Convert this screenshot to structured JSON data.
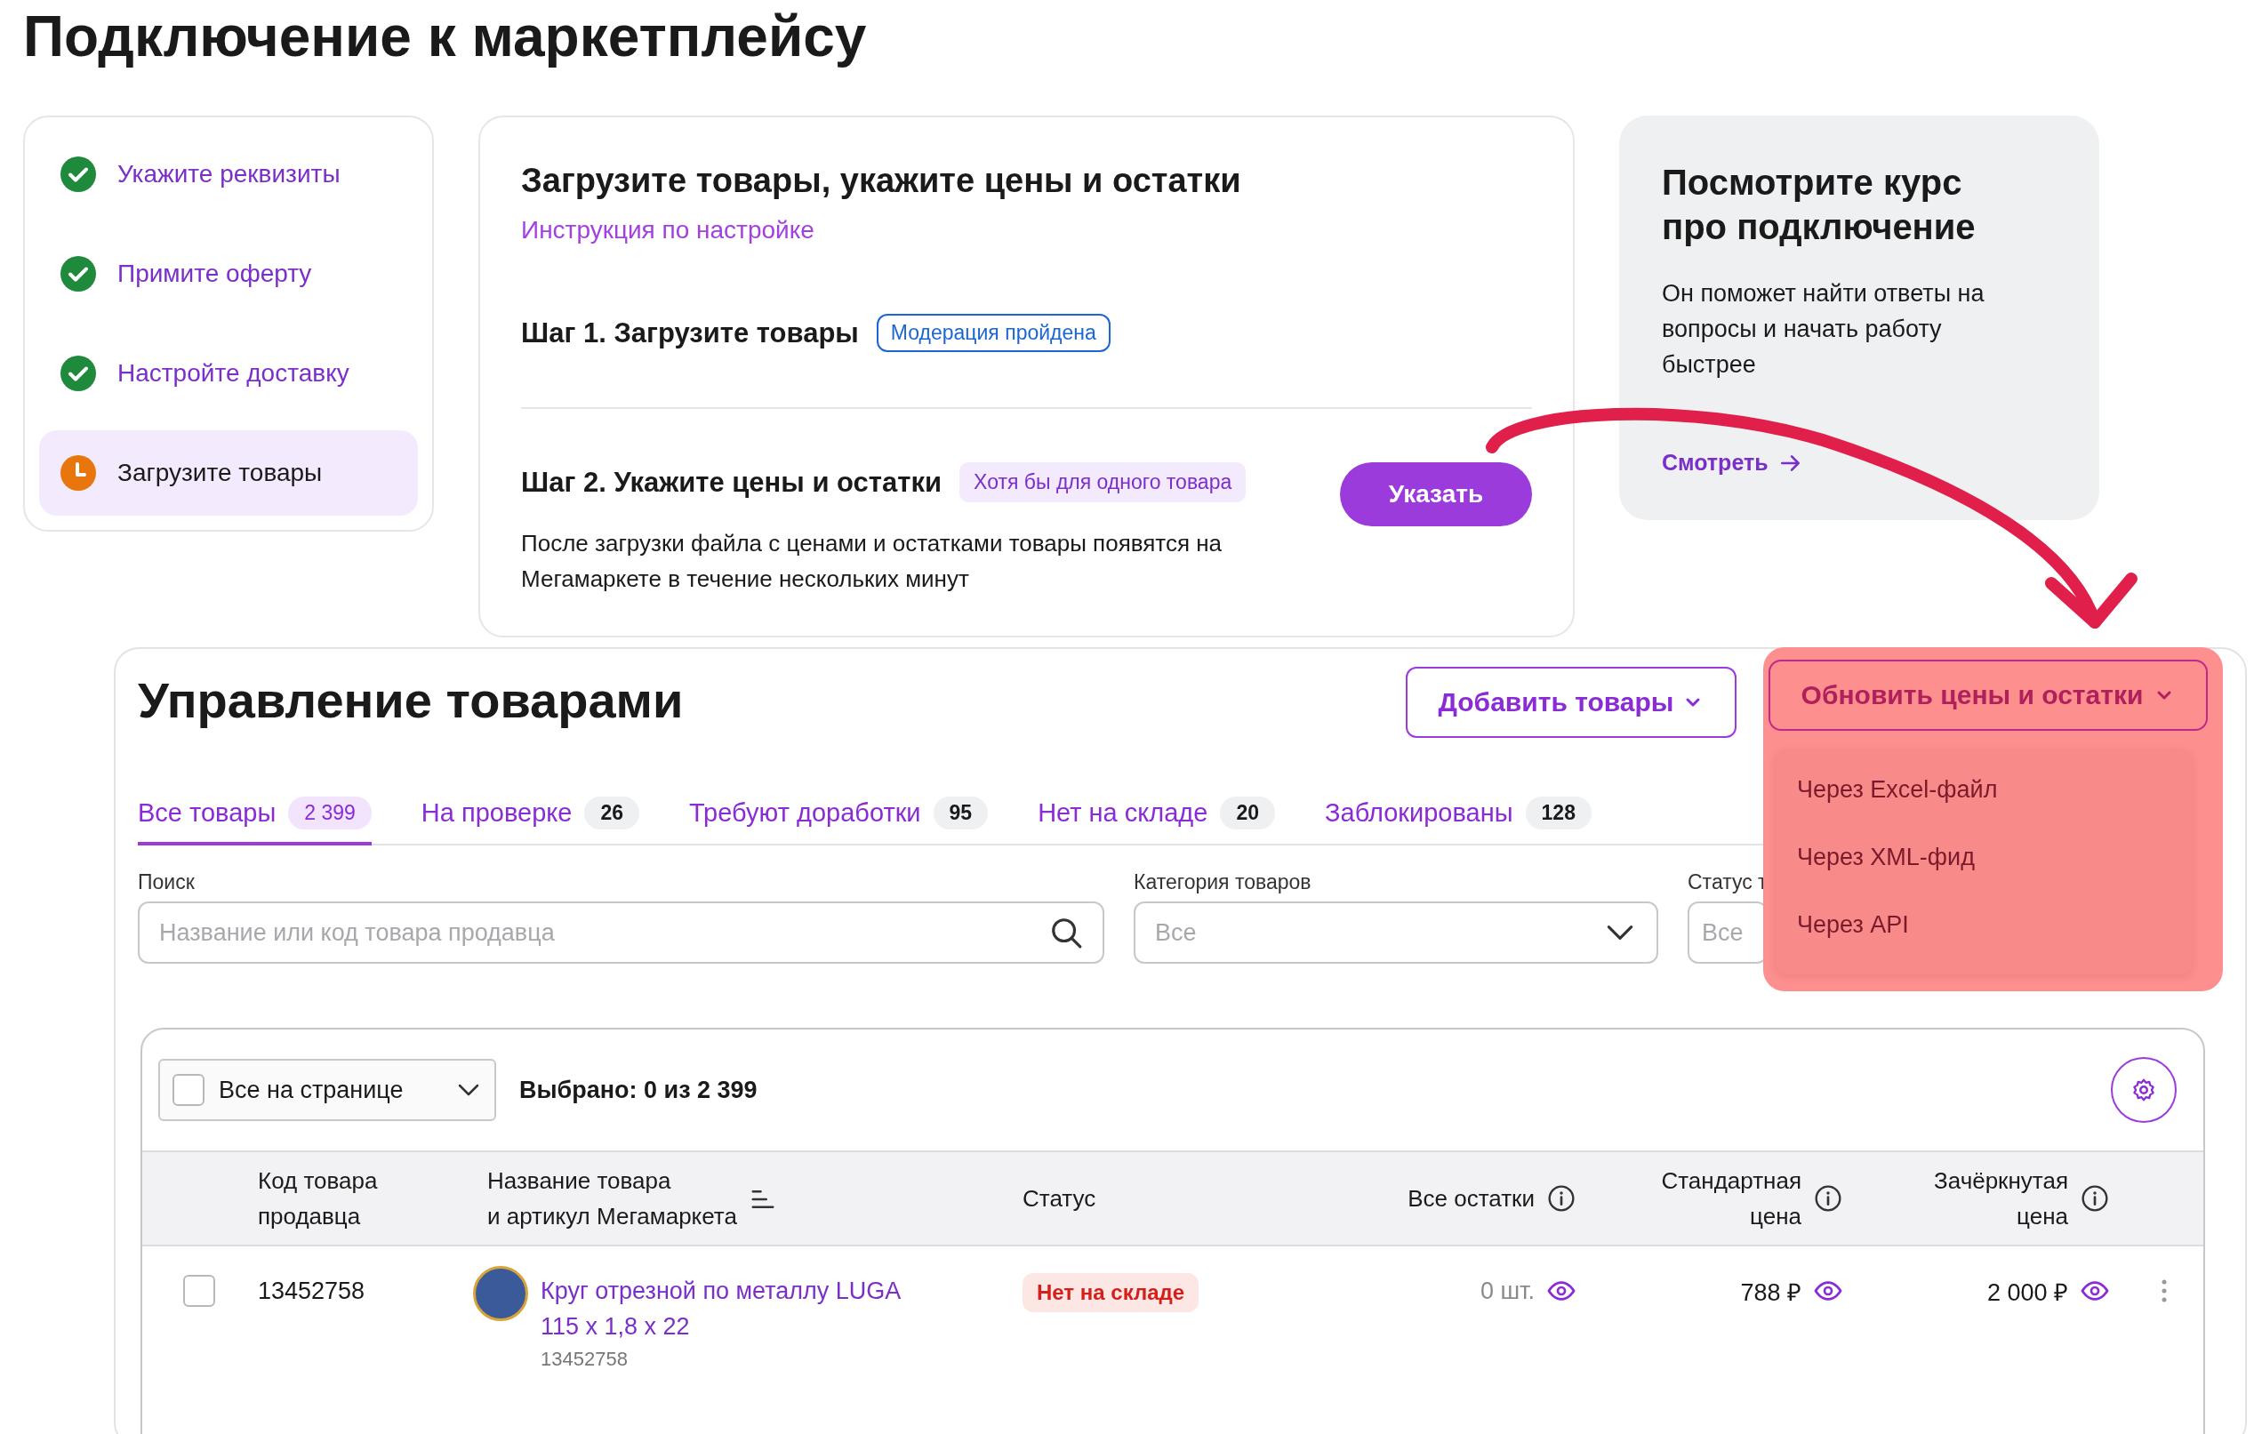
{
  "page_title": "Подключение к маркетплейсу",
  "steps": [
    {
      "label": "Укажите реквизиты",
      "done": true,
      "selected": false
    },
    {
      "label": "Примите оферту",
      "done": true,
      "selected": false
    },
    {
      "label": "Настройте доставку",
      "done": true,
      "selected": false
    },
    {
      "label": "Загрузите товары",
      "done": false,
      "selected": true
    }
  ],
  "setup_card": {
    "title": "Загрузите товары, укажите цены и остатки",
    "link": "Инструкция по настройке",
    "step1": {
      "title": "Шаг 1. Загрузите товары",
      "badge": "Модерация пройдена"
    },
    "step2": {
      "title": "Шаг 2. Укажите цены и остатки",
      "badge": "Хотя бы для одного товара",
      "description": "После загрузки файла с ценами и остатками товары появятся на Мегамаркете в течение нескольких минут",
      "button": "Указать"
    }
  },
  "course_card": {
    "title": "Посмотрите курс про подключение",
    "text": "Он поможет найти ответы на вопросы и начать работу быстрее",
    "link": "Смотреть"
  },
  "products": {
    "title": "Управление товарами",
    "add_button": "Добавить товары",
    "update_button": "Обновить цены и остатки",
    "update_menu": [
      "Через Excel-файл",
      "Через XML-фид",
      "Через API"
    ],
    "tabs": [
      {
        "label": "Все товары",
        "count": "2 399",
        "selected": true
      },
      {
        "label": "На проверке",
        "count": "26",
        "selected": false
      },
      {
        "label": "Требуют доработки",
        "count": "95",
        "selected": false
      },
      {
        "label": "Нет на складе",
        "count": "20",
        "selected": false
      },
      {
        "label": "Заблокированы",
        "count": "128",
        "selected": false
      }
    ],
    "filters": [
      {
        "kind": "search",
        "label": "Поиск",
        "placeholder": "Название или код товара продавца"
      },
      {
        "kind": "select",
        "label": "Категория товаров",
        "placeholder": "Все"
      },
      {
        "kind": "select",
        "label": "Статус т",
        "placeholder": "Все"
      }
    ],
    "toolbar": {
      "select_label": "Все на странице",
      "checked": false,
      "selected_count": "Выбрано: 0 из 2 399"
    },
    "table": {
      "columns": [
        {
          "label": "Код товара\nпродавца",
          "kind": "plain"
        },
        {
          "label": "Название товара\nи артикул Мегамаркета",
          "kind": "sortable"
        },
        {
          "label": "Статус",
          "kind": "plain"
        },
        {
          "label": "Все остатки",
          "kind": "info"
        },
        {
          "label": "Стандартная\nцена",
          "kind": "info"
        },
        {
          "label": "Зачёркнутая\nцена",
          "kind": "info"
        }
      ],
      "rows": [
        {
          "checked": false,
          "code": "13452758",
          "name": "Круг отрезной по металлу LUGA 115 х 1,8 х 22",
          "sku": "13452758",
          "status": "Нет на складе",
          "stock": "0 шт.",
          "price": "788 ₽",
          "old_price": "2 000 ₽"
        }
      ]
    }
  }
}
